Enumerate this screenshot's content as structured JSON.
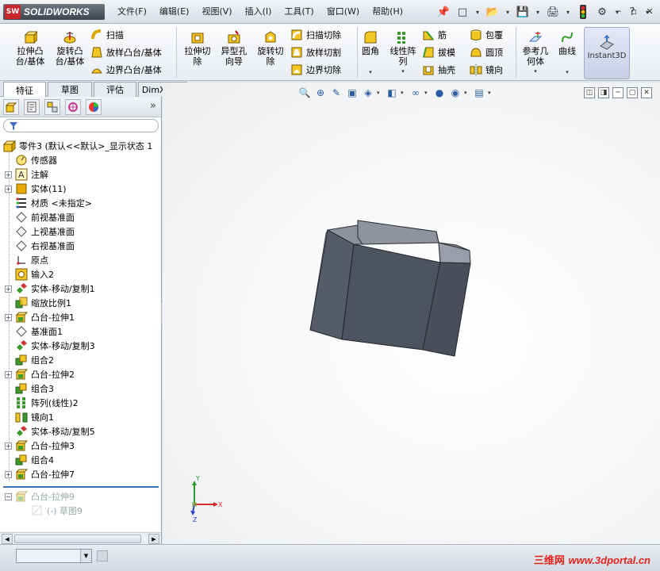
{
  "app": {
    "logo_mark": "SW",
    "logo_text": "SOLIDWORKS"
  },
  "menu": [
    "文件(F)",
    "编辑(E)",
    "视图(V)",
    "插入(I)",
    "工具(T)",
    "窗口(W)",
    "帮助(H)"
  ],
  "title_tools": {
    "pin": "📌",
    "new": "□",
    "open": "📂",
    "save": "💾",
    "print": "🖨",
    "traffic": "⚫",
    "options": "⚙",
    "help": "?",
    "dd": "▾"
  },
  "window_controls": {
    "minimize": "─",
    "restore": "▫",
    "close": "✕"
  },
  "commands": {
    "extrude_boss": "拉伸凸\n台/基体",
    "revolve_boss": "旋转凸\n台/基体",
    "sweep": "扫描",
    "loft_boss": "放样凸台/基体",
    "boundary_boss": "边界凸台/基体",
    "extrude_cut": "拉伸切\n除",
    "hole_wizard": "异型孔\n向导",
    "revolve_cut": "旋转切\n除",
    "sweep_cut": "扫描切除",
    "loft_cut": "放样切割",
    "boundary_cut": "边界切除",
    "fillet": "圆角",
    "linear_pattern": "线性阵\n列",
    "rib": "筋",
    "draft": "拔模",
    "shell": "抽壳",
    "wrap": "包覆",
    "dome": "圆顶",
    "mirror": "镜向",
    "ref_geometry": "参考几\n何体",
    "curves": "曲线",
    "instant3d": "Instant3D"
  },
  "tabs": [
    "特征",
    "草图",
    "评估",
    "DimXpert"
  ],
  "tree": {
    "root": "零件3  (默认<<默认>_显示状态 1",
    "items": [
      {
        "label": "传感器",
        "expand": false
      },
      {
        "label": "注解",
        "expand": true
      },
      {
        "label": "实体(11)",
        "expand": true
      },
      {
        "label": "材质 <未指定>",
        "expand": false
      },
      {
        "label": "前视基准面",
        "expand": false
      },
      {
        "label": "上视基准面",
        "expand": false
      },
      {
        "label": "右视基准面",
        "expand": false
      },
      {
        "label": "原点",
        "expand": false
      },
      {
        "label": "输入2",
        "expand": false
      },
      {
        "label": "实体-移动/复制1",
        "expand": true
      },
      {
        "label": "缩放比例1",
        "expand": false
      },
      {
        "label": "凸台-拉伸1",
        "expand": true
      },
      {
        "label": "基准面1",
        "expand": false
      },
      {
        "label": "实体-移动/复制3",
        "expand": false
      },
      {
        "label": "组合2",
        "expand": false
      },
      {
        "label": "凸台-拉伸2",
        "expand": true
      },
      {
        "label": "组合3",
        "expand": false
      },
      {
        "label": "阵列(线性)2",
        "expand": false
      },
      {
        "label": "镜向1",
        "expand": false
      },
      {
        "label": "实体-移动/复制5",
        "expand": false
      },
      {
        "label": "凸台-拉伸3",
        "expand": true
      },
      {
        "label": "组合4",
        "expand": false
      },
      {
        "label": "凸台-拉伸7",
        "expand": true
      }
    ],
    "rolled_back": [
      {
        "label": "凸台-拉伸9",
        "expand": true
      },
      {
        "label": "(-) 草图9",
        "expand": false
      }
    ]
  },
  "left_toolbar": {
    "more": "»"
  },
  "hud_icons": [
    "🔍",
    "⊕",
    "✎",
    "▣",
    "◈",
    "◧",
    "∞",
    "●",
    "◉",
    "▤"
  ],
  "viewport_controls": [
    "◫",
    "◨",
    "─",
    "▢",
    "✕"
  ],
  "status": {
    "watermark_a": "三维网",
    "watermark_b": "www.3dportal.cn"
  },
  "colors": {
    "accent": "#3b6fc4",
    "model": "#4e5360",
    "model_top": "#8c909c",
    "watermark": "#e2231a"
  }
}
